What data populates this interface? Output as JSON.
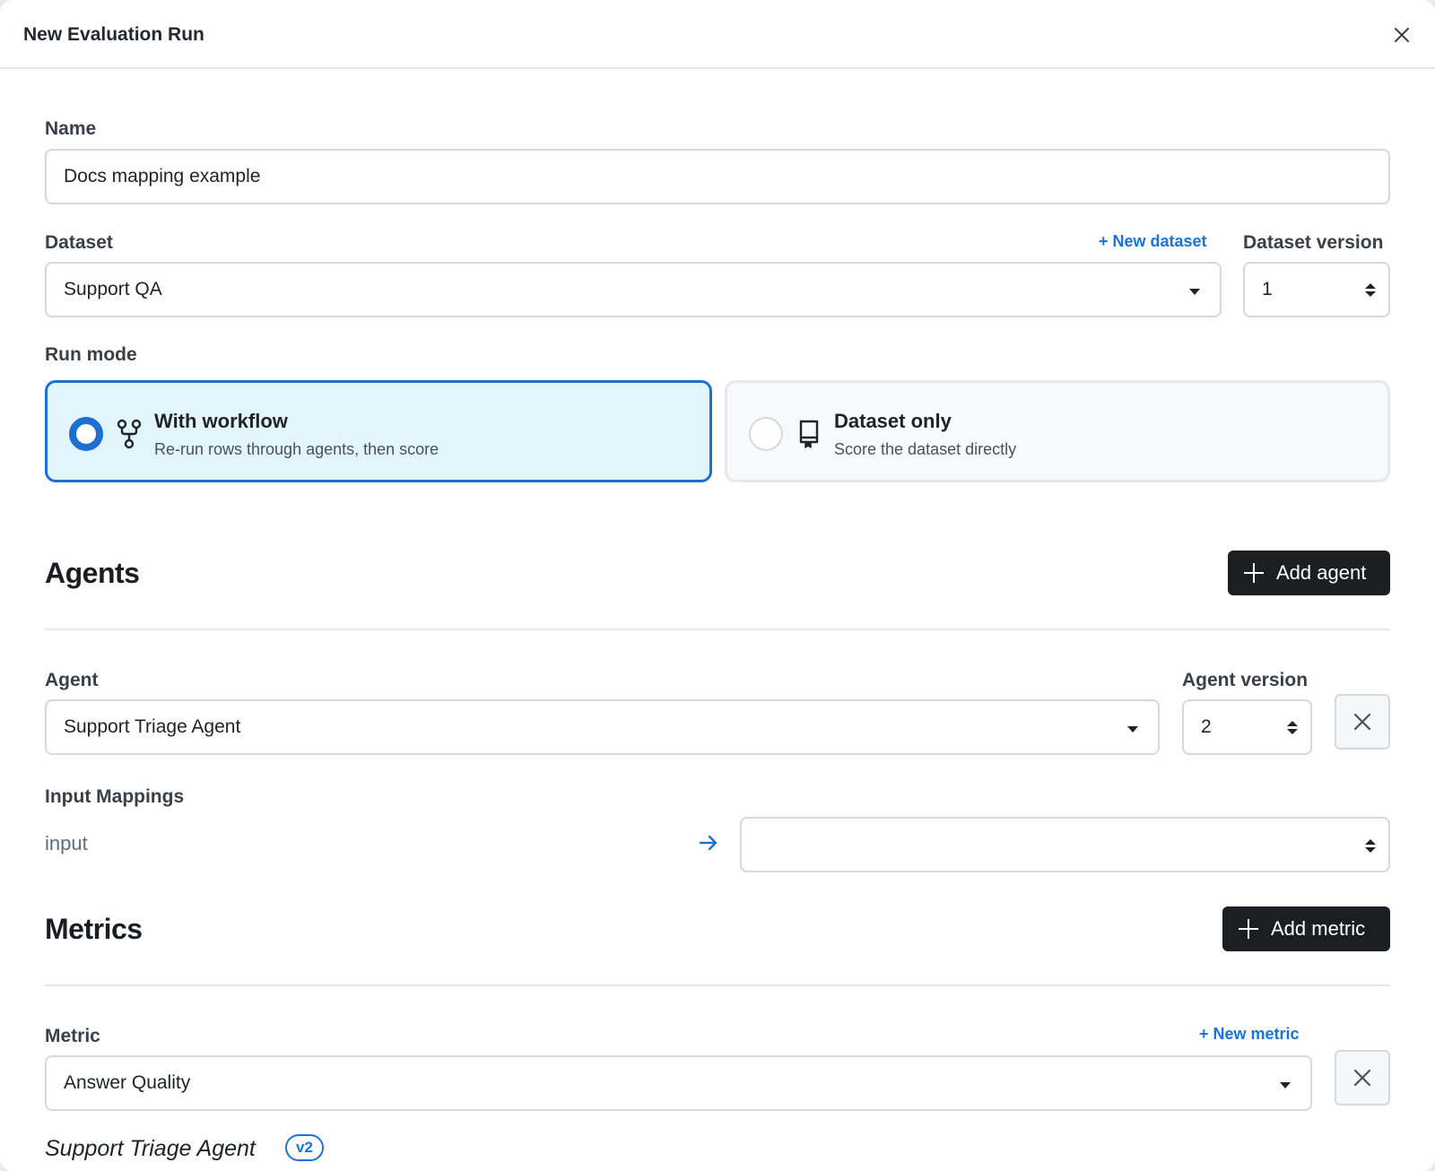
{
  "modal": {
    "title": "New Evaluation Run"
  },
  "form": {
    "name_label": "Name",
    "name_value": "Docs mapping example",
    "dataset_label": "Dataset",
    "new_dataset_link": "+ New dataset",
    "dataset_value": "Support QA",
    "dataset_version_label": "Dataset version",
    "dataset_version_value": "1",
    "run_mode_label": "Run mode",
    "run_modes": [
      {
        "title": "With workflow",
        "subtitle": "Re-run rows through agents, then score",
        "selected": true,
        "icon": "workflow-icon"
      },
      {
        "title": "Dataset only",
        "subtitle": "Score the dataset directly",
        "selected": false,
        "icon": "receipt-icon"
      }
    ]
  },
  "agents": {
    "section_title": "Agents",
    "add_button": "Add agent",
    "agent_label": "Agent",
    "agent_value": "Support Triage Agent",
    "agent_version_label": "Agent version",
    "agent_version_value": "2",
    "input_mappings_label": "Input Mappings",
    "mappings": [
      {
        "key": "input",
        "value": ""
      }
    ]
  },
  "metrics": {
    "section_title": "Metrics",
    "add_button": "Add metric",
    "metric_label": "Metric",
    "new_metric_link": "+ New metric",
    "metric_value": "Answer Quality",
    "agent_ref": "Support Triage Agent",
    "agent_ref_version": "v2"
  },
  "colors": {
    "accent": "#1d6fd0",
    "selected_card_bg": "#e2f5fd",
    "dark_button": "#1c1e21"
  }
}
